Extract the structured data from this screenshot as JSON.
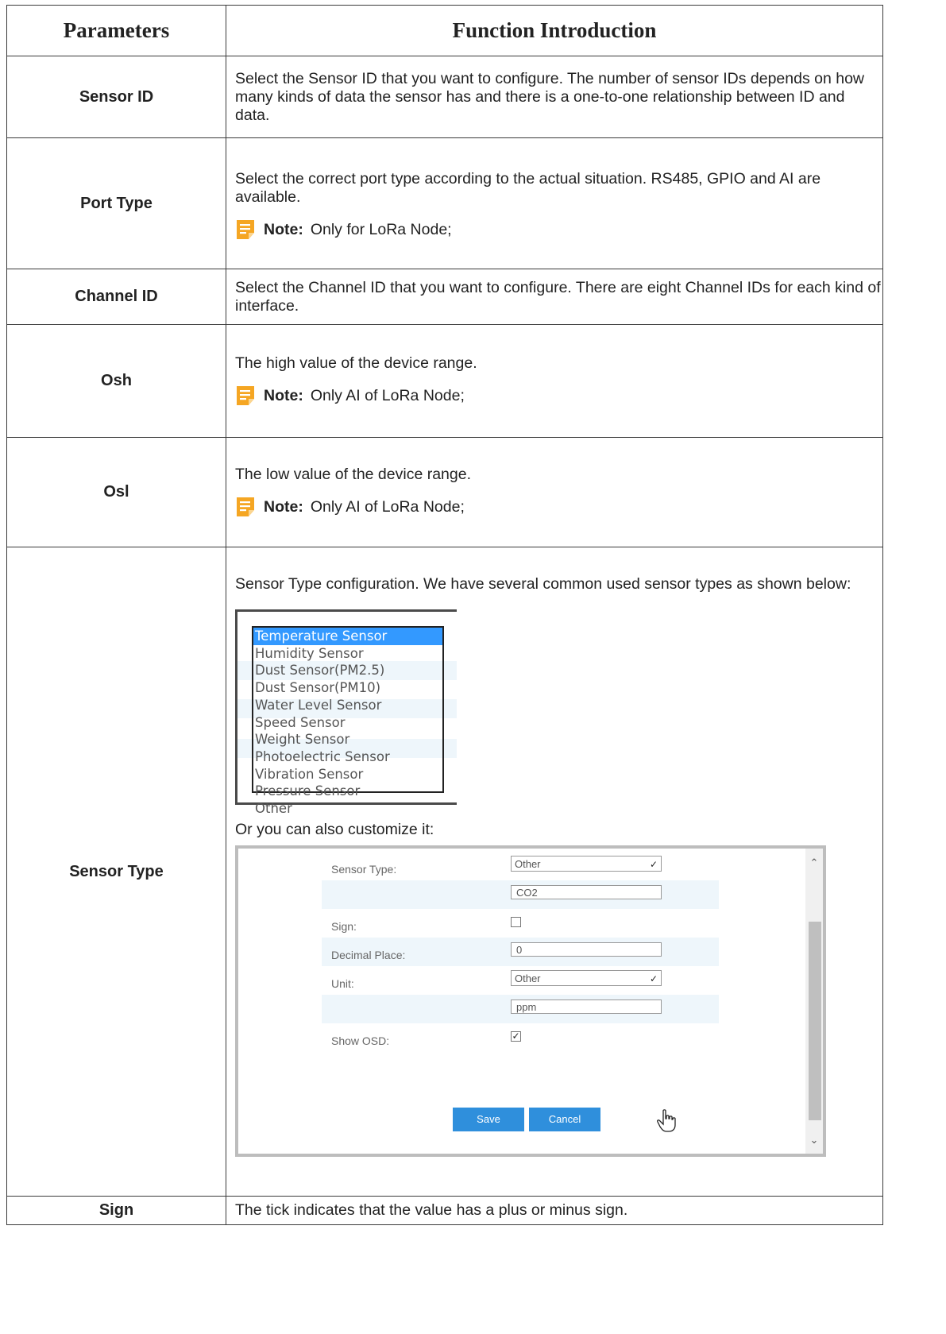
{
  "table": {
    "header_param": "Parameters",
    "header_function": "Function Introduction"
  },
  "rows": {
    "sensor_id": {
      "param": "Sensor ID",
      "desc": "Select the Sensor ID that you want to configure. The number of sensor IDs depends on how many kinds of data the sensor has and there is a one-to-one relationship between ID and data."
    },
    "port_type": {
      "param": "Port Type",
      "desc": "Select the correct port type according to the actual situation. RS485, GPIO and AI are available.",
      "note_label": "Note:",
      "note_text": "Only for LoRa Node;"
    },
    "channel_id": {
      "param": "Channel ID",
      "desc": "Select the Channel ID that you want to configure. There are eight Channel IDs for each kind of interface."
    },
    "osh": {
      "param": "Osh",
      "desc": "The high value of the device range.",
      "note_label": "Note:",
      "note_text": "Only AI of LoRa Node;"
    },
    "osl": {
      "param": "Osl",
      "desc": "The low value of the device range.",
      "note_label": "Note:",
      "note_text": "Only AI of LoRa Node;"
    },
    "sensor_type": {
      "param": "Sensor Type",
      "desc": "Sensor Type configuration. We have several common used sensor types as shown below:",
      "customize_text": "Or you can also customize it:",
      "options": [
        "Temperature Sensor",
        "Humidity Sensor",
        "Dust Sensor(PM2.5)",
        "Dust Sensor(PM10)",
        "Water Level Sensor",
        "Speed Sensor",
        "Weight Sensor",
        "Photoelectric Sensor",
        "Vibration Sensor",
        "Pressure Sensor",
        "Other"
      ],
      "form": {
        "sensor_type_label": "Sensor Type:",
        "sensor_type_value": "Other",
        "custom_type_value": "CO2",
        "sign_label": "Sign:",
        "decimal_label": "Decimal Place:",
        "decimal_value": "0",
        "unit_label": "Unit:",
        "unit_value": "Other",
        "custom_unit_value": "ppm",
        "show_osd_label": "Show OSD:",
        "save_label": "Save",
        "cancel_label": "Cancel"
      }
    },
    "sign": {
      "param": "Sign",
      "desc": "The tick indicates that the value has a plus or minus sign."
    }
  },
  "colors": {
    "note_icon": "#f5a623",
    "selected_option": "#3399ff",
    "button": "#2f8fdc",
    "stripe": "#eef6fb"
  },
  "icons": [
    "note-icon",
    "chevron-down-icon",
    "checkmark-icon",
    "scroll-up-icon",
    "scroll-down-icon",
    "hand-cursor-icon"
  ]
}
